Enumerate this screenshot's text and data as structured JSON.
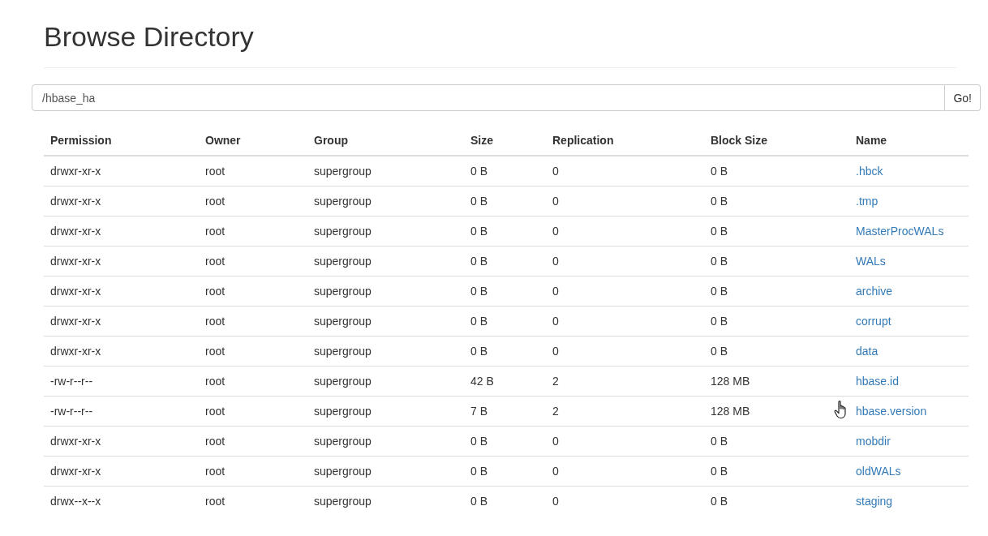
{
  "title": "Browse Directory",
  "path_field": {
    "value": "/hbase_ha"
  },
  "go_button": "Go!",
  "table": {
    "columns": [
      "Permission",
      "Owner",
      "Group",
      "Size",
      "Replication",
      "Block Size",
      "Name"
    ],
    "rows": [
      {
        "permission": "drwxr-xr-x",
        "owner": "root",
        "group": "supergroup",
        "size": "0 B",
        "replication": "0",
        "block_size": "0 B",
        "name": ".hbck"
      },
      {
        "permission": "drwxr-xr-x",
        "owner": "root",
        "group": "supergroup",
        "size": "0 B",
        "replication": "0",
        "block_size": "0 B",
        "name": ".tmp"
      },
      {
        "permission": "drwxr-xr-x",
        "owner": "root",
        "group": "supergroup",
        "size": "0 B",
        "replication": "0",
        "block_size": "0 B",
        "name": "MasterProcWALs"
      },
      {
        "permission": "drwxr-xr-x",
        "owner": "root",
        "group": "supergroup",
        "size": "0 B",
        "replication": "0",
        "block_size": "0 B",
        "name": "WALs"
      },
      {
        "permission": "drwxr-xr-x",
        "owner": "root",
        "group": "supergroup",
        "size": "0 B",
        "replication": "0",
        "block_size": "0 B",
        "name": "archive"
      },
      {
        "permission": "drwxr-xr-x",
        "owner": "root",
        "group": "supergroup",
        "size": "0 B",
        "replication": "0",
        "block_size": "0 B",
        "name": "corrupt"
      },
      {
        "permission": "drwxr-xr-x",
        "owner": "root",
        "group": "supergroup",
        "size": "0 B",
        "replication": "0",
        "block_size": "0 B",
        "name": "data"
      },
      {
        "permission": "-rw-r--r--",
        "owner": "root",
        "group": "supergroup",
        "size": "42 B",
        "replication": "2",
        "block_size": "128 MB",
        "name": "hbase.id"
      },
      {
        "permission": "-rw-r--r--",
        "owner": "root",
        "group": "supergroup",
        "size": "7 B",
        "replication": "2",
        "block_size": "128 MB",
        "name": "hbase.version",
        "hovered": true
      },
      {
        "permission": "drwxr-xr-x",
        "owner": "root",
        "group": "supergroup",
        "size": "0 B",
        "replication": "0",
        "block_size": "0 B",
        "name": "mobdir"
      },
      {
        "permission": "drwxr-xr-x",
        "owner": "root",
        "group": "supergroup",
        "size": "0 B",
        "replication": "0",
        "block_size": "0 B",
        "name": "oldWALs"
      },
      {
        "permission": "drwx--x--x",
        "owner": "root",
        "group": "supergroup",
        "size": "0 B",
        "replication": "0",
        "block_size": "0 B",
        "name": "staging"
      }
    ]
  }
}
